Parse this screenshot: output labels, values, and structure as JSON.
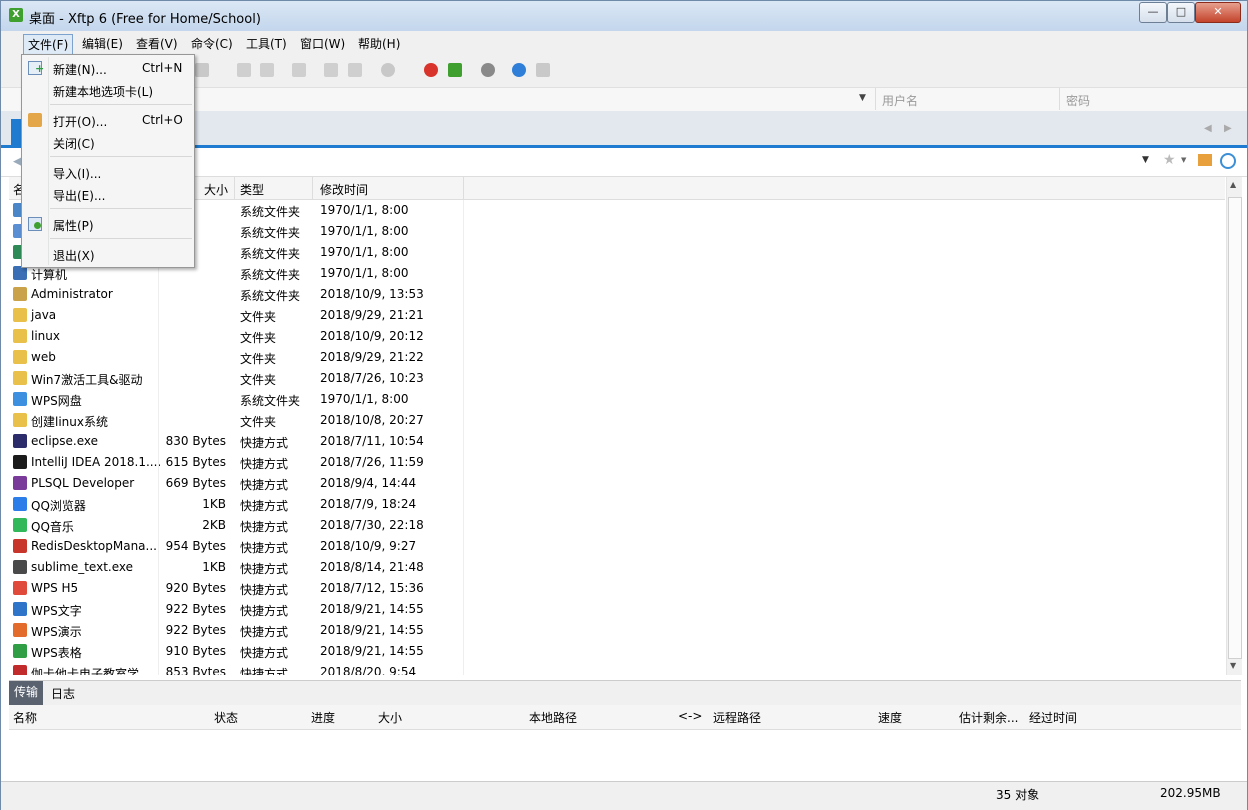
{
  "window": {
    "title": "桌面 - Xftp 6 (Free for Home/School)",
    "app_icon_letter": "X"
  },
  "window_controls": {
    "minimize": "—",
    "maximize": "□",
    "close": "✕"
  },
  "menubar": [
    {
      "label": "文件(F)"
    },
    {
      "label": "编辑(E)"
    },
    {
      "label": "查看(V)"
    },
    {
      "label": "命令(C)"
    },
    {
      "label": "工具(T)"
    },
    {
      "label": "窗口(W)"
    },
    {
      "label": "帮助(H)"
    }
  ],
  "address": {
    "username_placeholder": "用户名",
    "password_placeholder": "密码"
  },
  "file_menu": {
    "items": [
      {
        "label": "新建(N)...",
        "shortcut": "Ctrl+N",
        "icon": "new-session-icon"
      },
      {
        "label": "新建本地选项卡(L)",
        "shortcut": ""
      },
      {
        "label": "打开(O)...",
        "shortcut": "Ctrl+O",
        "icon": "open-folder-icon"
      },
      {
        "label": "关闭(C)",
        "shortcut": ""
      },
      {
        "label": "导入(I)...",
        "shortcut": ""
      },
      {
        "label": "导出(E)...",
        "shortcut": ""
      },
      {
        "label": "属性(P)",
        "shortcut": "",
        "icon": "properties-icon"
      },
      {
        "label": "退出(X)",
        "shortcut": ""
      }
    ]
  },
  "file_list": {
    "columns": {
      "name": "名",
      "size": "大小",
      "type": "类型",
      "modified": "修改时间"
    },
    "rows": [
      {
        "name": "",
        "size": "",
        "type": "系统文件夹",
        "modified": "1970/1/1, 8:00",
        "icon_color": "#4a86c8"
      },
      {
        "name": "",
        "size": "",
        "type": "系统文件夹",
        "modified": "1970/1/1, 8:00",
        "icon_color": "#5b8fd3"
      },
      {
        "name": "",
        "size": "",
        "type": "系统文件夹",
        "modified": "1970/1/1, 8:00",
        "icon_color": "#2e8b57"
      },
      {
        "name": "计算机",
        "size": "",
        "type": "系统文件夹",
        "modified": "1970/1/1, 8:00",
        "icon_color": "#3a6fb5"
      },
      {
        "name": "Administrator",
        "size": "",
        "type": "系统文件夹",
        "modified": "2018/10/9, 13:53",
        "icon_color": "#c9a24a"
      },
      {
        "name": "java",
        "size": "",
        "type": "文件夹",
        "modified": "2018/9/29, 21:21",
        "icon_color": "#e8c04a"
      },
      {
        "name": "linux",
        "size": "",
        "type": "文件夹",
        "modified": "2018/10/9, 20:12",
        "icon_color": "#e8c04a"
      },
      {
        "name": "web",
        "size": "",
        "type": "文件夹",
        "modified": "2018/9/29, 21:22",
        "icon_color": "#e8c04a"
      },
      {
        "name": "Win7激活工具&驱动",
        "size": "",
        "type": "文件夹",
        "modified": "2018/7/26, 10:23",
        "icon_color": "#e8c04a"
      },
      {
        "name": "WPS网盘",
        "size": "",
        "type": "系统文件夹",
        "modified": "1970/1/1, 8:00",
        "icon_color": "#3d8fe0"
      },
      {
        "name": "创建linux系统",
        "size": "",
        "type": "文件夹",
        "modified": "2018/10/8, 20:27",
        "icon_color": "#e8c04a"
      },
      {
        "name": "eclipse.exe",
        "size": "830 Bytes",
        "type": "快捷方式",
        "modified": "2018/7/11, 10:54",
        "icon_color": "#2c2c6a"
      },
      {
        "name": "IntelliJ IDEA 2018.1....",
        "size": "615 Bytes",
        "type": "快捷方式",
        "modified": "2018/7/26, 11:59",
        "icon_color": "#1b1b1b"
      },
      {
        "name": "PLSQL Developer",
        "size": "669 Bytes",
        "type": "快捷方式",
        "modified": "2018/9/4, 14:44",
        "icon_color": "#7a3a9a"
      },
      {
        "name": "QQ浏览器",
        "size": "1KB",
        "type": "快捷方式",
        "modified": "2018/7/9, 18:24",
        "icon_color": "#2b7de9"
      },
      {
        "name": "QQ音乐",
        "size": "2KB",
        "type": "快捷方式",
        "modified": "2018/7/30, 22:18",
        "icon_color": "#30b85b"
      },
      {
        "name": "RedisDesktopMana...",
        "size": "954 Bytes",
        "type": "快捷方式",
        "modified": "2018/10/9, 9:27",
        "icon_color": "#c8362b"
      },
      {
        "name": "sublime_text.exe",
        "size": "1KB",
        "type": "快捷方式",
        "modified": "2018/8/14, 21:48",
        "icon_color": "#4a4a4a"
      },
      {
        "name": "WPS H5",
        "size": "920 Bytes",
        "type": "快捷方式",
        "modified": "2018/7/12, 15:36",
        "icon_color": "#e04a3a"
      },
      {
        "name": "WPS文字",
        "size": "922 Bytes",
        "type": "快捷方式",
        "modified": "2018/9/21, 14:55",
        "icon_color": "#2e74c9"
      },
      {
        "name": "WPS演示",
        "size": "922 Bytes",
        "type": "快捷方式",
        "modified": "2018/9/21, 14:55",
        "icon_color": "#e36b2b"
      },
      {
        "name": "WPS表格",
        "size": "910 Bytes",
        "type": "快捷方式",
        "modified": "2018/9/21, 14:55",
        "icon_color": "#2f9e44"
      },
      {
        "name": "伽卡他卡电子教室学...",
        "size": "853 Bytes",
        "type": "快捷方式",
        "modified": "2018/8/20, 9:54",
        "icon_color": "#c22b2b"
      }
    ]
  },
  "bottom_tabs": [
    {
      "label": "传输"
    },
    {
      "label": "日志"
    }
  ],
  "transfer_columns": [
    "名称",
    "状态",
    "进度",
    "大小",
    "本地路径",
    "<->",
    "远程路径",
    "速度",
    "估计剩余...",
    "经过时间"
  ],
  "status": {
    "objects": "35 对象",
    "size": "202.95MB"
  }
}
